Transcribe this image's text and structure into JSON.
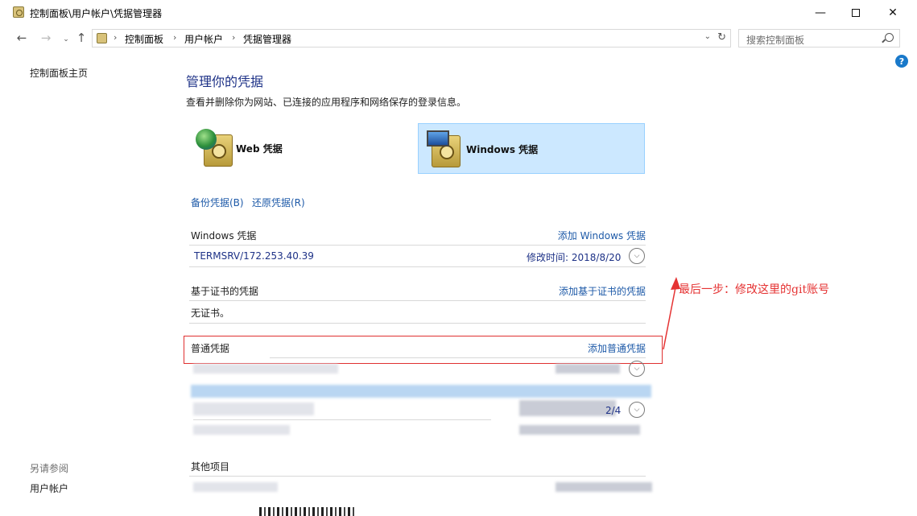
{
  "window": {
    "title": "控制面板\\用户帐户\\凭据管理器"
  },
  "address": {
    "segments": [
      "控制面板",
      "用户帐户",
      "凭据管理器"
    ],
    "search_placeholder": "搜索控制面板"
  },
  "left_pane": {
    "home_link": "控制面板主页",
    "see_also": "另请参阅",
    "user_accounts_link": "用户帐户"
  },
  "main": {
    "title": "管理你的凭据",
    "description": "查看并删除你为网站、已连接的应用程序和网络保存的登录信息。",
    "tiles": [
      {
        "label": "Web 凭据",
        "selected": false
      },
      {
        "label": "Windows 凭据",
        "selected": true
      }
    ],
    "actions": {
      "backup": "备份凭据(B)",
      "restore": "还原凭据(R)"
    },
    "sections": {
      "windows": {
        "heading": "Windows 凭据",
        "add_link": "添加 Windows 凭据",
        "items": [
          {
            "name": "TERMSRV/172.253.40.39",
            "modified": "修改时间:  2018/8/20"
          }
        ]
      },
      "certificate": {
        "heading": "基于证书的凭据",
        "add_link": "添加基于证书的凭据",
        "empty_text": "无证书。"
      },
      "generic": {
        "heading": "普通凭据",
        "add_link": "添加普通凭据",
        "partial_date": "2/4"
      },
      "other": {
        "heading": "其他项目"
      }
    }
  },
  "annotation": {
    "text": "最后一步：修改这里的git账号",
    "color": "#e53333"
  },
  "colors": {
    "link": "#1e5aa8",
    "title": "#1e3287",
    "selected_tile": "#cce8ff",
    "highlight_box": "#e03030"
  }
}
